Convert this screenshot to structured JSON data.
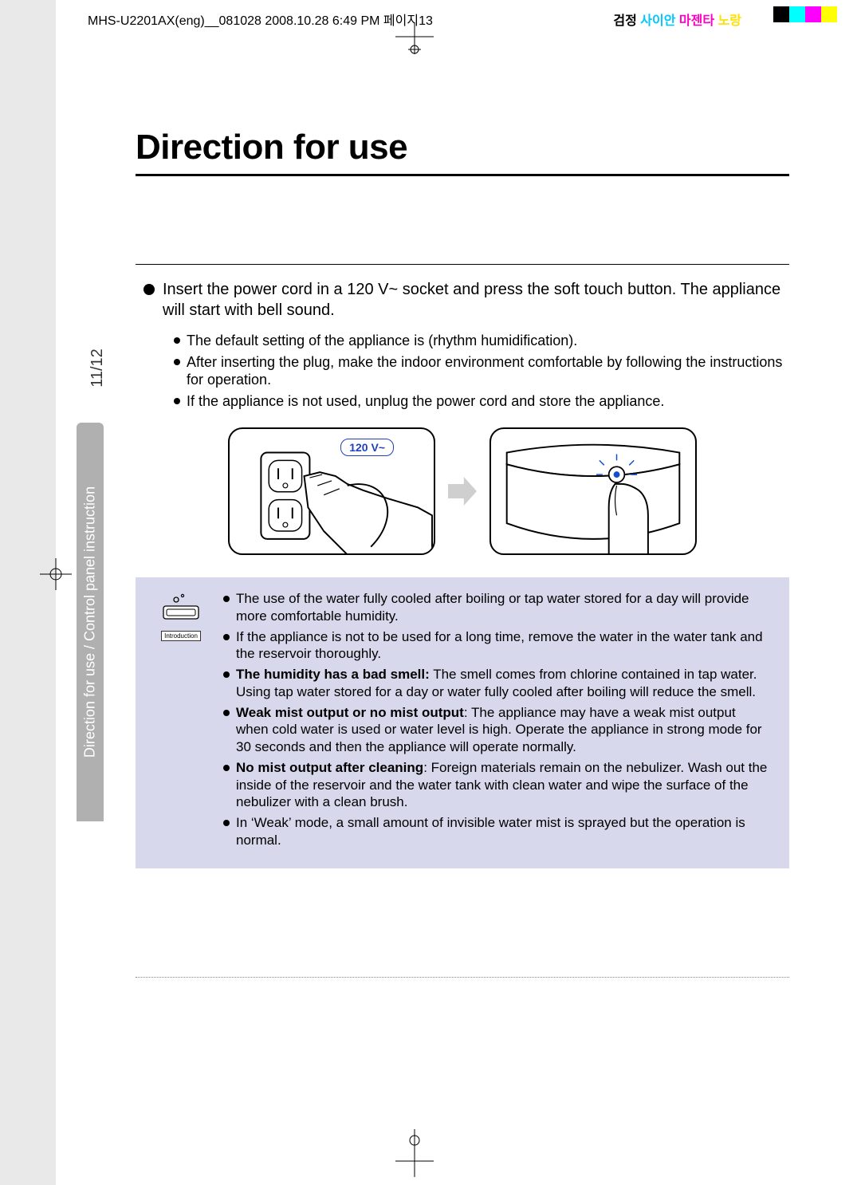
{
  "header": {
    "fileinfo": "MHS-U2201AX(eng)__081028  2008.10.28 6:49 PM  페이지13",
    "colors": {
      "k": "검정",
      "c": "사이안",
      "m": "마젠타",
      "y": "노랑"
    }
  },
  "title": "Direction for use",
  "lead": "Insert the power cord in a 120 V~ socket and press the soft touch button. The appliance will start with bell sound.",
  "bullets": [
    "The default setting of the appliance is (rhythm humidification).",
    "After inserting the plug, make the indoor environment comfortable by following the instructions for operation.",
    "If the appliance is not used, unplug the power cord and store the appliance."
  ],
  "figure": {
    "voltage_label": "120 V~"
  },
  "intro_label": "Introduction",
  "info": [
    {
      "bold": "",
      "text": "The use of the water fully cooled after boiling or tap water stored for a day will provide more comfortable humidity."
    },
    {
      "bold": "",
      "text": "If the appliance is not to be used for a long time, remove the water in the water tank and the reservoir thoroughly."
    },
    {
      "bold": "The humidity has a bad smell:",
      "text": " The smell comes from chlorine contained in tap water.\nUsing tap water stored for a day or water fully cooled after boiling will reduce the smell."
    },
    {
      "bold": "Weak mist output or no mist output",
      "text": ": The appliance may have a weak mist output when cold water is used or water level is high. Operate the appliance in strong mode for 30 seconds and then the appliance will operate normally."
    },
    {
      "bold": "No mist output after cleaning",
      "text": ": Foreign materials remain on the nebulizer. Wash out the inside of the reservoir and the water tank with clean water and wipe the surface of the nebulizer with a clean brush."
    },
    {
      "bold": "",
      "text": "In ‘Weak’ mode, a small amount of invisible water mist is sprayed but the operation is normal."
    }
  ],
  "sidetab": "Direction for use / Control panel instruction",
  "pagenum": "11/12"
}
